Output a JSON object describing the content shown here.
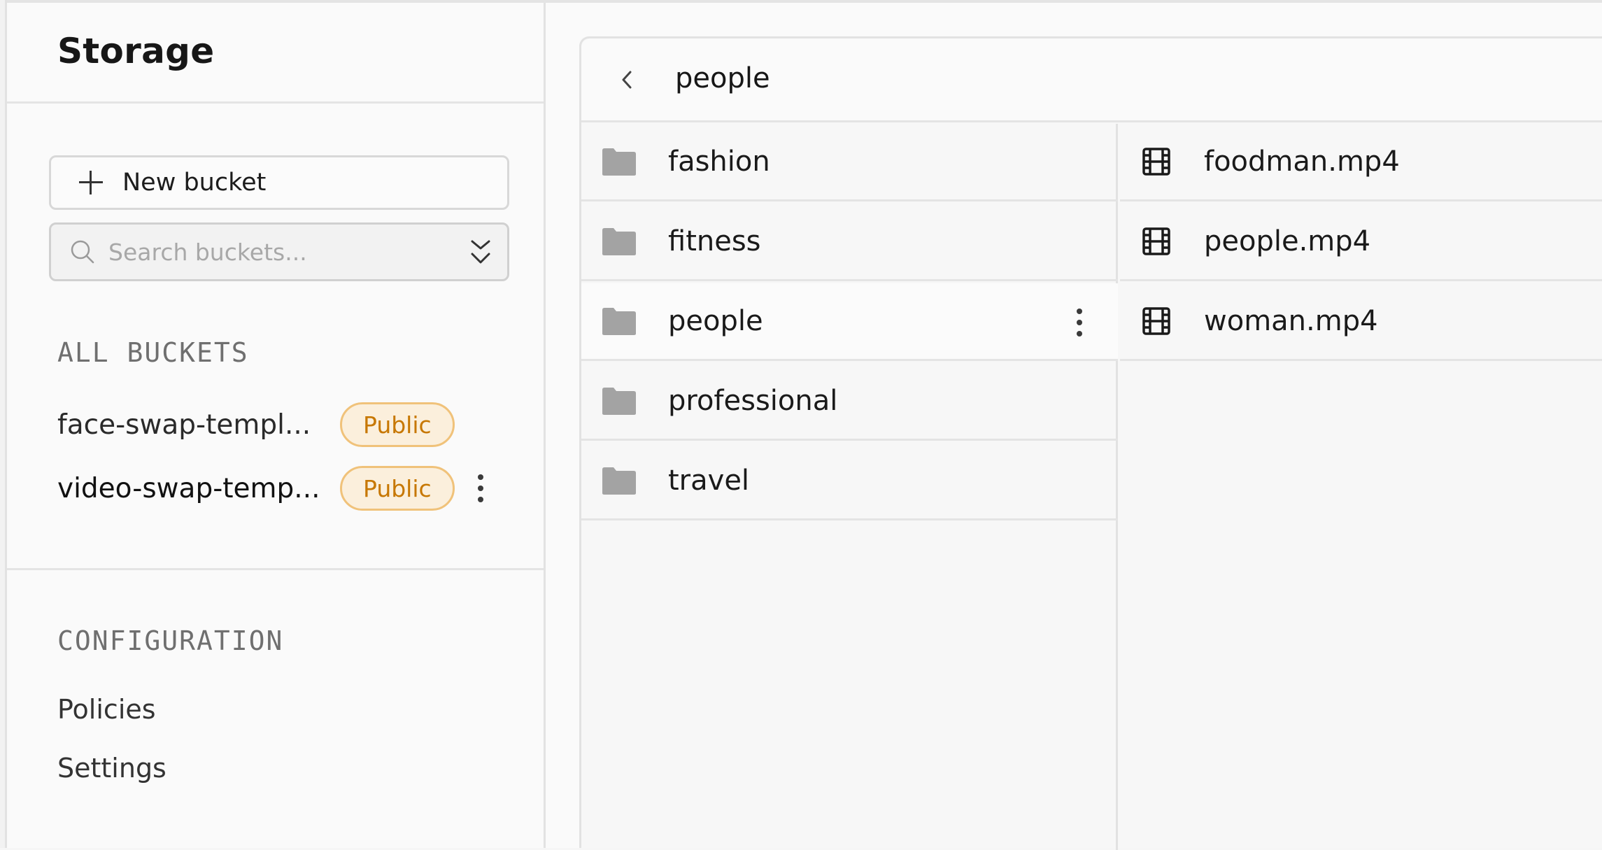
{
  "sidebar": {
    "title": "Storage",
    "new_bucket_label": "New bucket",
    "search_placeholder": "Search buckets...",
    "all_buckets_label": "ALL BUCKETS",
    "buckets": [
      {
        "name": "face-swap-templ...",
        "badge": "Public"
      },
      {
        "name": "video-swap-temp...",
        "badge": "Public"
      }
    ],
    "configuration_label": "CONFIGURATION",
    "config_items": [
      "Policies",
      "Settings"
    ]
  },
  "explorer": {
    "title": "people",
    "folders": [
      "fashion",
      "fitness",
      "people",
      "professional",
      "travel"
    ],
    "selected_folder": "people",
    "files": [
      "foodman.mp4",
      "people.mp4",
      "woman.mp4"
    ]
  },
  "colors": {
    "badge_text": "#c77700",
    "badge_bg": "#fbefdc",
    "badge_border": "#f0c27a",
    "folder_icon": "#a3a3a3"
  },
  "icons": {
    "back": "chevron-left-icon",
    "folder": "folder-icon",
    "file": "film-icon",
    "search": "search-icon",
    "sort": "chevrons-up-down-icon",
    "more": "more-vertical-icon"
  }
}
